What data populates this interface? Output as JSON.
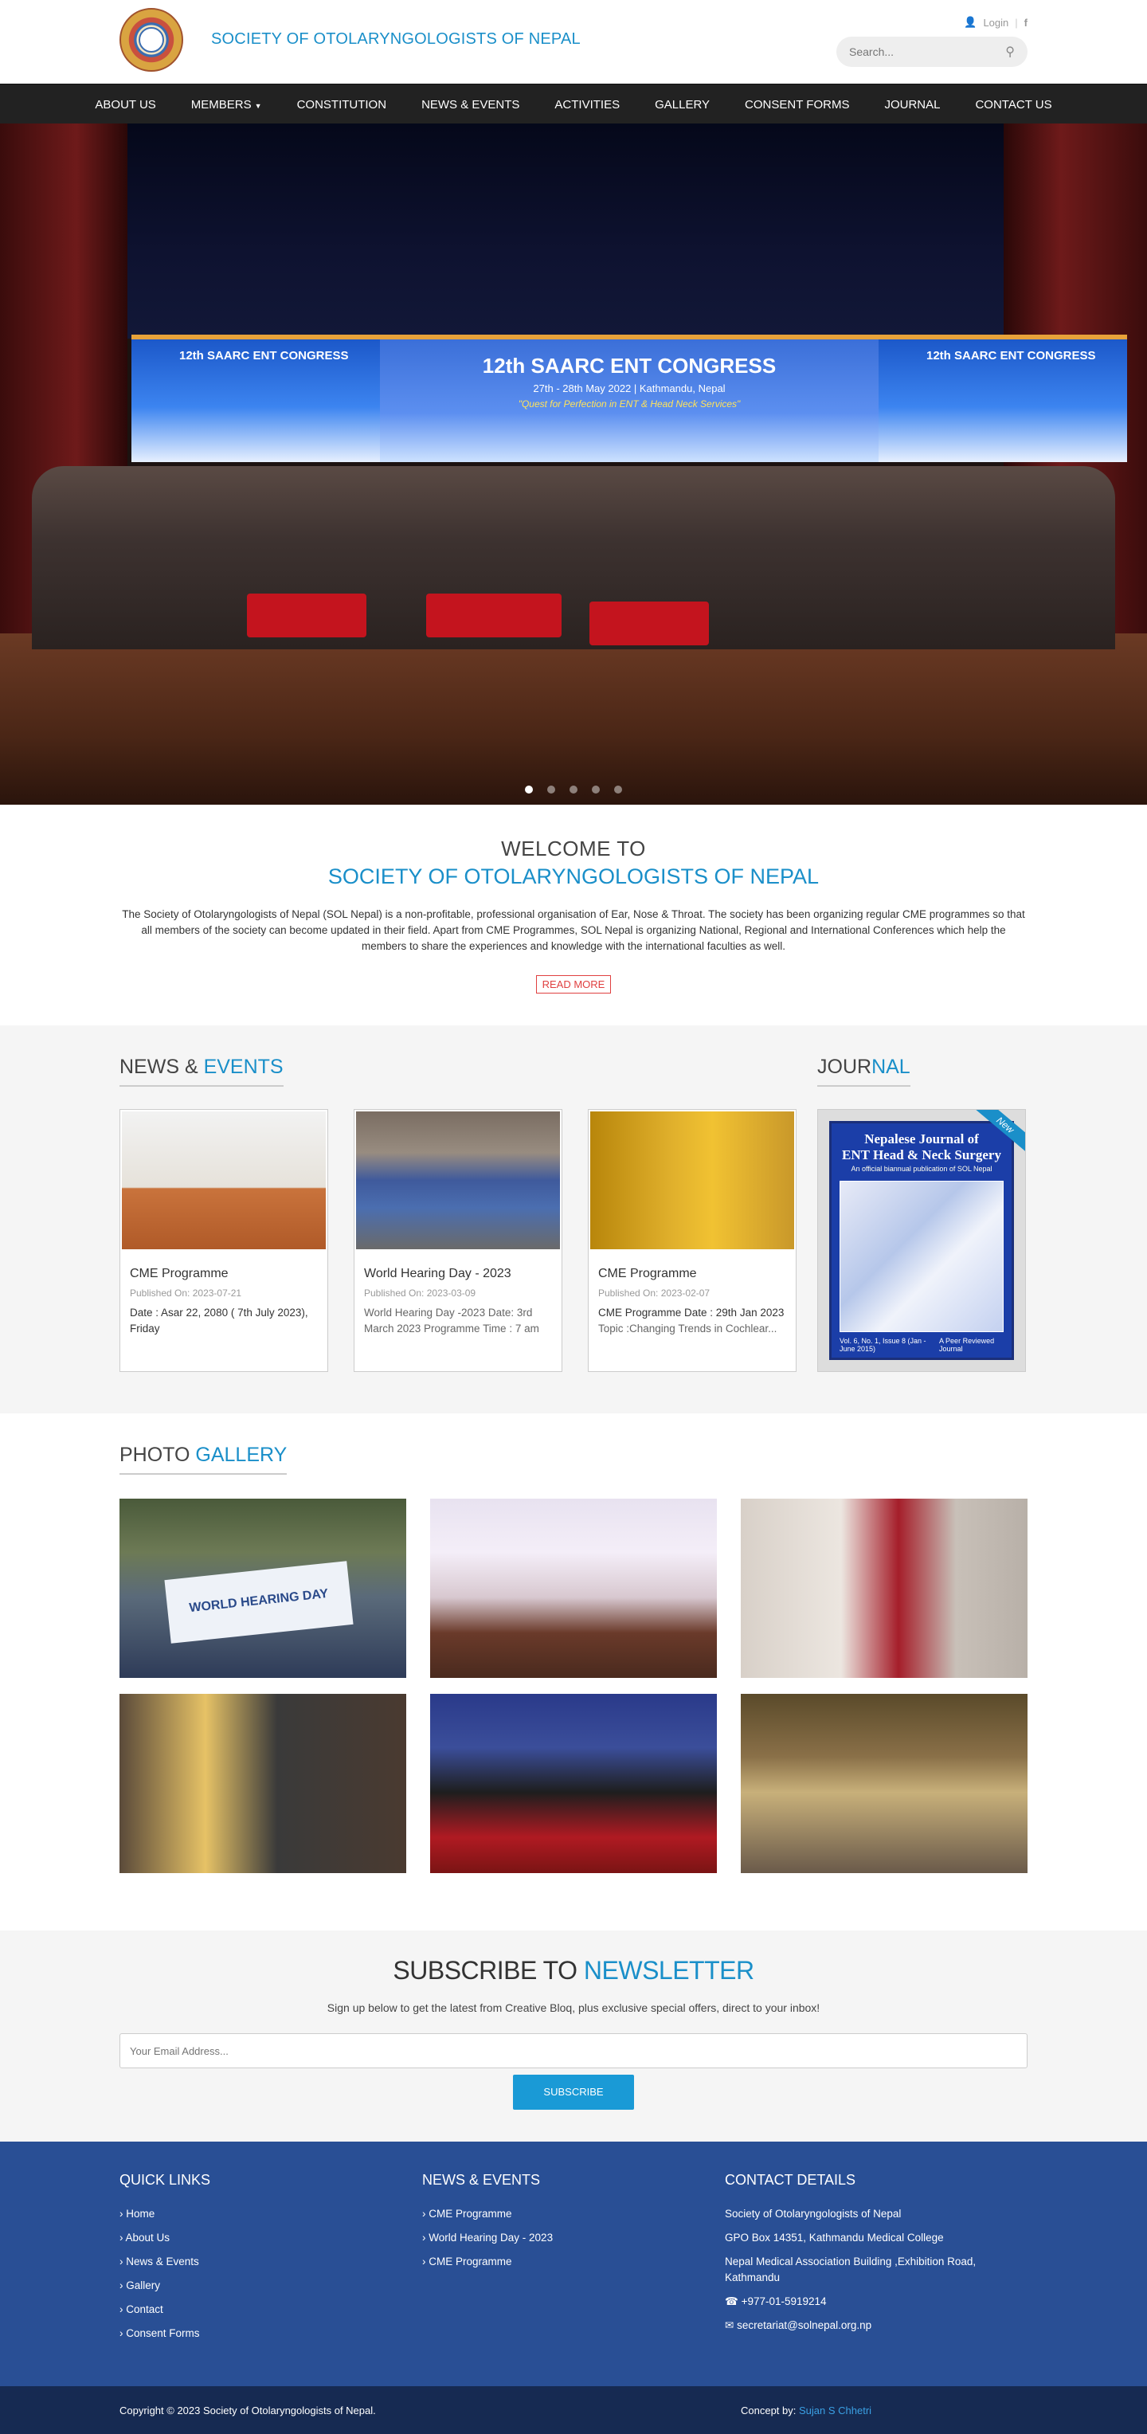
{
  "header": {
    "site_name": "SOCIETY OF OTOLARYNGOLOGISTS OF NEPAL",
    "login_label": "Login",
    "search_placeholder": "Search..."
  },
  "nav": {
    "items": [
      "ABOUT US",
      "MEMBERS",
      "CONSTITUTION",
      "NEWS & EVENTS",
      "ACTIVITIES",
      "GALLERY",
      "CONSENT FORMS",
      "JOURNAL",
      "CONTACT US"
    ]
  },
  "slider": {
    "banner_title": "12th SAARC ENT CONGRESS",
    "banner_sub": "27th - 28th May 2022 | Kathmandu, Nepal",
    "banner_tag": "\"Quest for Perfection in ENT & Head Neck Services\"",
    "side_title": "12th SAARC ENT CONGRESS",
    "active_slide": 1,
    "slide_count": 5
  },
  "welcome": {
    "heading": "WELCOME TO",
    "subheading": "SOCIETY OF OTOLARYNGOLOGISTS OF NEPAL",
    "body": "The Society of Otolaryngologists of Nepal (SOL Nepal) is a non-profitable, professional organisation of Ear, Nose & Throat. The society has been organizing regular CME programmes so that all members of the society can become updated in their field. Apart from CME Programmes, SOL Nepal is organizing National, Regional and International Conferences which help the members to share the experiences and knowledge with the international faculties as well.",
    "read_more": "READ MORE"
  },
  "news": {
    "title_a": "NEWS &",
    "title_b": "EVENTS",
    "items": [
      {
        "title": "CME Programme",
        "published": "Published On: 2023-07-21",
        "desc": "Date : Asar 22, 2080 ( 7th July 2023), Friday",
        "desc_extra": ""
      },
      {
        "title": "World Hearing Day - 2023",
        "published": "Published On: 2023-03-09",
        "desc": "",
        "desc_extra": "World Hearing Day -2023 Date: 3rd March 2023 Programme Time : 7 am"
      },
      {
        "title": "CME Programme",
        "published": "Published On: 2023-02-07",
        "desc": "CME Programme    Date :  29th Jan 2023",
        "desc_extra": " Topic :Changing Trends in Cochlear..."
      }
    ]
  },
  "journal": {
    "title_a": "JOUR",
    "title_b": "NAL",
    "cover_title_a": "Nepalese Journal of",
    "cover_title_b": "ENT Head & Neck Surgery",
    "cover_sub": "An official biannual publication of SOL Nepal",
    "ribbon": "New",
    "cover_footer_left": "Vol. 6, No. 1, Issue 8 (Jan - June 2015)",
    "cover_footer_right": "A Peer Reviewed Journal"
  },
  "gallery": {
    "title_a": "PHOTO",
    "title_b": "GALLERY",
    "banner_text": "WORLD HEARING DAY"
  },
  "subscribe": {
    "title_a": "SUBSCRIBE TO",
    "title_b": "NEWSLETTER",
    "text": "Sign up below to get the latest from Creative Bloq, plus exclusive special offers, direct to your inbox!",
    "placeholder": "Your Email Address...",
    "button": "SUBSCRIBE"
  },
  "footer": {
    "quick_links_title": "QUICK LINKS",
    "quick_links": [
      "Home",
      "About Us",
      "News & Events",
      "Gallery",
      "Contact",
      "Consent Forms"
    ],
    "news_title": "NEWS & EVENTS",
    "news_links": [
      "CME Programme",
      "World Hearing Day - 2023",
      "CME Programme"
    ],
    "contact_title": "CONTACT DETAILS",
    "contact_org": "Society of Otolaryngologists of Nepal",
    "contact_gpo": "GPO Box 14351, Kathmandu Medical College",
    "contact_addr": "Nepal Medical Association Building ,Exhibition Road, Kathmandu",
    "contact_phone": "+977-01-5919214",
    "contact_email": "secretariat@solnepal.org.np"
  },
  "copyright": {
    "text": "Copyright © 2023 Society of Otolaryngologists of Nepal.",
    "concept_label": "Concept by:",
    "concept_name": "Sujan S Chhetri"
  },
  "colors": {
    "accent": "#1a8fc9",
    "nav_bg": "#222222",
    "footer_bg": "#294f95",
    "copyright_bg": "#162a52",
    "read_more": "#e04040"
  }
}
